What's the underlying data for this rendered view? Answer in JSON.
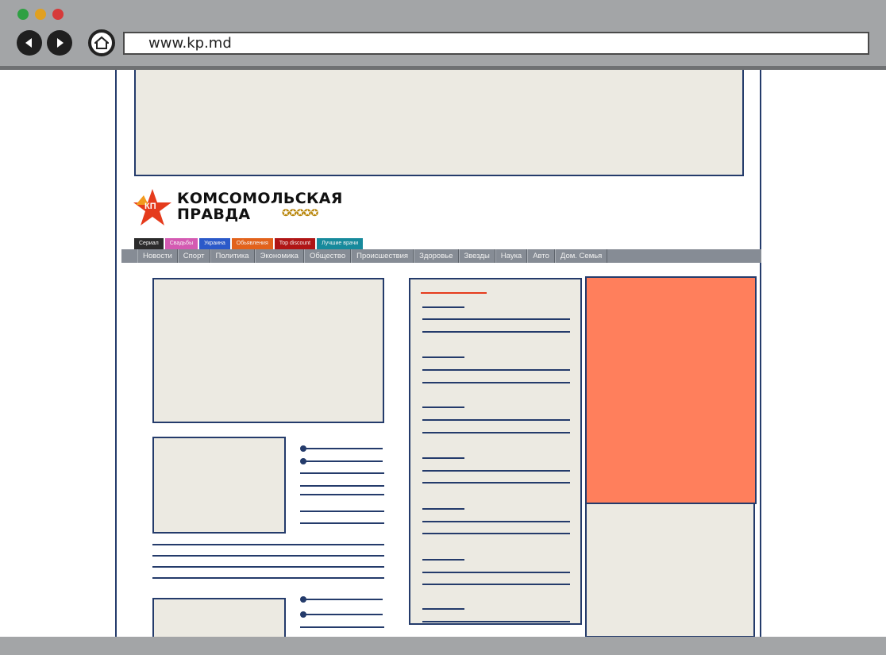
{
  "browser": {
    "url": "www.kp.md",
    "traffic_lights": [
      "#2ea043",
      "#e0a020",
      "#d63a3a"
    ],
    "back_icon": "back-arrow-icon",
    "forward_icon": "forward-arrow-icon",
    "home_icon": "home-icon"
  },
  "logo": {
    "badge": "КП",
    "title": "КОМСОМОЛЬСКАЯ\nПРАВДА"
  },
  "colored_tabs": [
    {
      "label": "Сериал",
      "color": "#2b2b2b"
    },
    {
      "label": "Свадьбы",
      "color": "#d45ab2"
    },
    {
      "label": "Украина",
      "color": "#2b59c9"
    },
    {
      "label": "Обьявления",
      "color": "#e2621b"
    },
    {
      "label": "Top discount",
      "color": "#b01515"
    },
    {
      "label": "Лучшие врачи",
      "color": "#178a9c"
    }
  ],
  "nav": [
    "Новости",
    "Спорт",
    "Политика",
    "Экономика",
    "Общество",
    "Происшествия",
    "Здоровье",
    "Звезды",
    "Наука",
    "Авто",
    "Дом. Семья"
  ],
  "colors": {
    "accent_ad": "#ff7f5c",
    "placeholder": "#eceae2",
    "border": "#243b6b",
    "chrome": "#a3a5a7"
  }
}
